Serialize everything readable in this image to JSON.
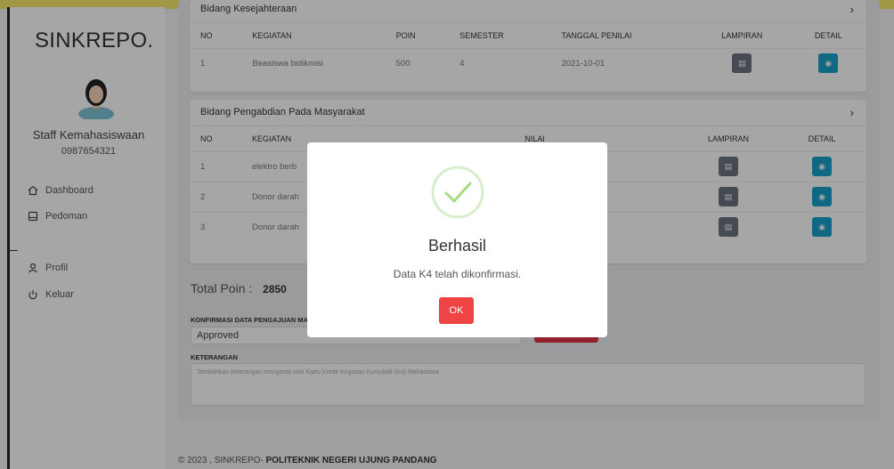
{
  "brand": "SINKREPO.",
  "user": {
    "name": "Staff Kemahasiswaan",
    "phone": "0987654321"
  },
  "nav": [
    {
      "label": "Dashboard",
      "icon": "home-icon"
    },
    {
      "label": "Pedoman",
      "icon": "book-icon"
    },
    {
      "label": "Profil",
      "icon": "user-icon"
    },
    {
      "label": "Keluar",
      "icon": "power-icon"
    }
  ],
  "card1": {
    "title": "Bidang Kesejahteraan",
    "headers": [
      "NO",
      "KEGIATAN",
      "POIN",
      "SEMESTER",
      "TANGGAL PENILAI",
      "LAMPIRAN",
      "DETAIL"
    ],
    "rows": [
      {
        "no": "1",
        "kegiatan": "Beasiswa bidikmisi",
        "poin": "500",
        "semester": "4",
        "tanggal": "2021-10-01"
      }
    ]
  },
  "card2": {
    "title": "Bidang Pengabdian Pada Masyarakat",
    "headers": [
      "NO",
      "KEGIATAN",
      "NILAI",
      "LAMPIRAN",
      "DETAIL"
    ],
    "rows": [
      {
        "no": "1",
        "kegiatan": "elektro berb"
      },
      {
        "no": "2",
        "kegiatan": "Donor darah"
      },
      {
        "no": "3",
        "kegiatan": "Donor darah"
      }
    ]
  },
  "total": {
    "label": "Total Poin :",
    "value": "2850"
  },
  "konfirmasi": {
    "label": "KONFIRMASI DATA PENGAJUAN MA",
    "value": "Approved"
  },
  "keterangan": {
    "label": "KETERANGAN",
    "placeholder": "Tambahkan keterangan mengenai nilai Kartu Kredit Kegiatan Kumulatif (K4) Mahasiswa"
  },
  "footer": {
    "prefix": "© 2023 , SINKREPO- ",
    "org": "POLITEKNIK NEGERI UJUNG PANDANG"
  },
  "modal": {
    "title": "Berhasil",
    "text": "Data K4 telah dikonfirmasi.",
    "ok": "OK"
  },
  "colors": {
    "accent_cyan": "#17a2c8",
    "gray_btn": "#6b7280",
    "red": "#ef4444",
    "success": "#a5dc86"
  }
}
